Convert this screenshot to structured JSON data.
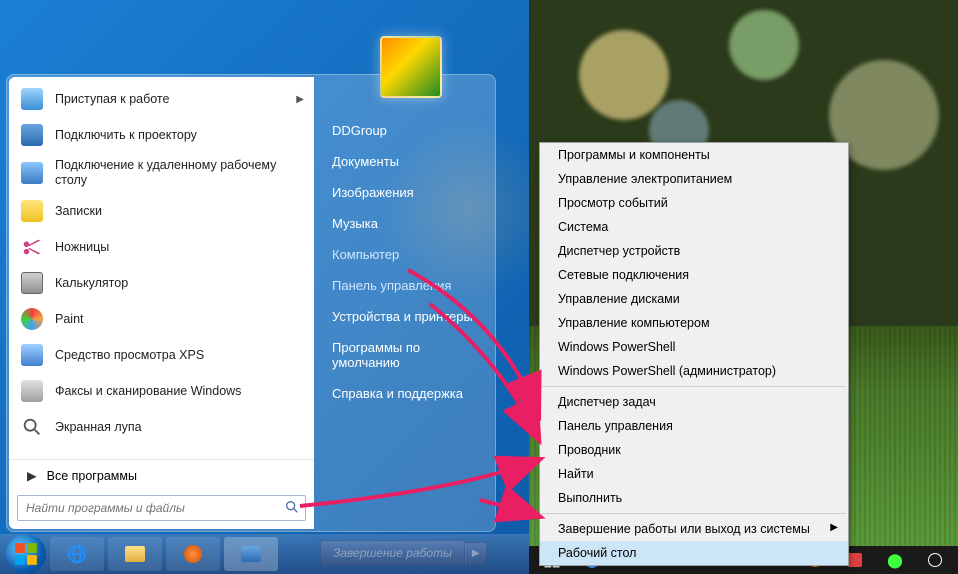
{
  "win7": {
    "programs": [
      {
        "label": "Приступая к работе",
        "has_submenu": true
      },
      {
        "label": "Подключить к проектору"
      },
      {
        "label": "Подключение к удаленному рабочему столу"
      },
      {
        "label": "Записки"
      },
      {
        "label": "Ножницы"
      },
      {
        "label": "Калькулятор"
      },
      {
        "label": "Paint"
      },
      {
        "label": "Средство просмотра XPS"
      },
      {
        "label": "Факсы и сканирование Windows"
      },
      {
        "label": "Экранная лупа"
      }
    ],
    "all_programs": "Все программы",
    "search_placeholder": "Найти программы и файлы",
    "right_panel": [
      "DDGroup",
      "Документы",
      "Изображения",
      "Музыка",
      "Компьютер",
      "Панель управления",
      "Устройства и принтеры",
      "Программы по умолчанию",
      "Справка и поддержка"
    ],
    "shutdown_label": "Завершение работы"
  },
  "win8": {
    "context_menu_top": [
      "Программы и компоненты",
      "Управление электропитанием",
      "Просмотр событий",
      "Система",
      "Диспетчер устройств",
      "Сетевые подключения",
      "Управление дисками",
      "Управление компьютером",
      "Windows PowerShell",
      "Windows PowerShell (администратор)"
    ],
    "context_menu_mid": [
      "Диспетчер задач",
      "Панель управления",
      "Проводник",
      "Найти",
      "Выполнить"
    ],
    "context_menu_bottom": [
      {
        "label": "Завершение работы или выход из системы",
        "arrow": true
      },
      {
        "label": "Рабочий стол",
        "highlight": true
      }
    ]
  }
}
